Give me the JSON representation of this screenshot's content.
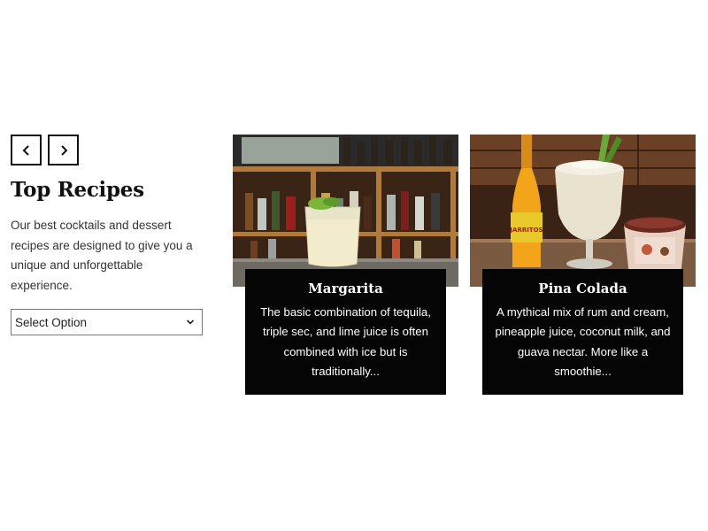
{
  "intro": {
    "prev_icon": "chevron-left-icon",
    "next_icon": "chevron-right-icon",
    "title": "Top Recipes",
    "description": "Our best cocktails and dessert recipes are designed to give you a unique and unforgettable experience.",
    "select": {
      "value": "Select Option",
      "icon": "chevron-down-icon"
    }
  },
  "cards": [
    {
      "title": "Margarita",
      "text": "The basic combination of tequila, triple sec, and lime juice is often combined with ice but is traditionally..."
    },
    {
      "title": "Pina Colada",
      "text": "A mythical mix of rum and cream, pineapple juice, coconut milk, and guava nectar. More like a smoothie...",
      "bottle_label": "JARRITOS"
    }
  ]
}
